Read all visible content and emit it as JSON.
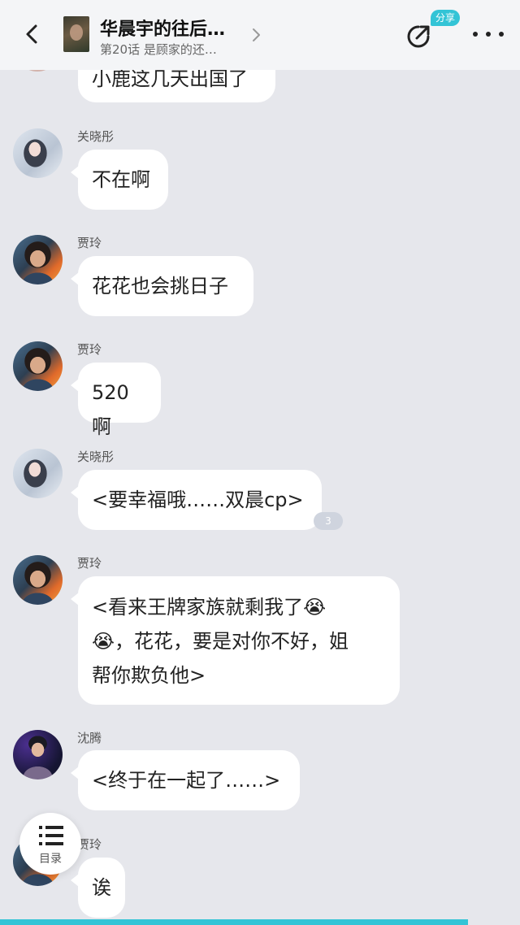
{
  "header": {
    "title": "华晨宇的往后…",
    "subtitle": "第20话 是顾家的还…",
    "share_label": "分享"
  },
  "messages": [
    {
      "speaker": "",
      "text": "小鹿这几天出国了"
    },
    {
      "speaker": "关晓彤",
      "text": "不在啊"
    },
    {
      "speaker": "贾玲",
      "text": "花花也会挑日子"
    },
    {
      "speaker": "贾玲",
      "text": "520啊"
    },
    {
      "speaker": "关晓彤",
      "text": "<要幸福哦……双晨cp>",
      "count": "3"
    },
    {
      "speaker": "贾玲",
      "text_lines": [
        "<看来王牌家族就剩我了😭",
        "😭，花花，要是对你不好，姐",
        "帮你欺负他>"
      ]
    },
    {
      "speaker": "沈腾",
      "text": "<终于在一起了……>"
    },
    {
      "speaker": "贾玲",
      "text": "诶"
    }
  ],
  "toc": {
    "label": "目录"
  },
  "reading_progress": 0.9,
  "colors": {
    "accent": "#33c4d6",
    "background": "#e6e7ec",
    "bubble": "#ffffff"
  },
  "icons": [
    "back-chevron-icon",
    "chevron-right-icon",
    "share-icon",
    "more-dots-icon",
    "list-icon"
  ]
}
